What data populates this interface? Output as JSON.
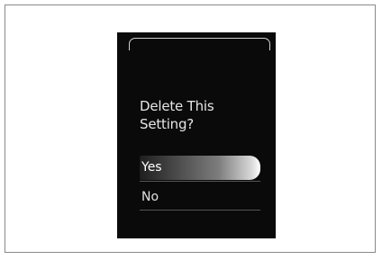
{
  "dialog": {
    "prompt_line1": "Delete This",
    "prompt_line2": "Setting?",
    "options": [
      {
        "label": "Yes",
        "selected": true
      },
      {
        "label": "No",
        "selected": false
      }
    ]
  }
}
